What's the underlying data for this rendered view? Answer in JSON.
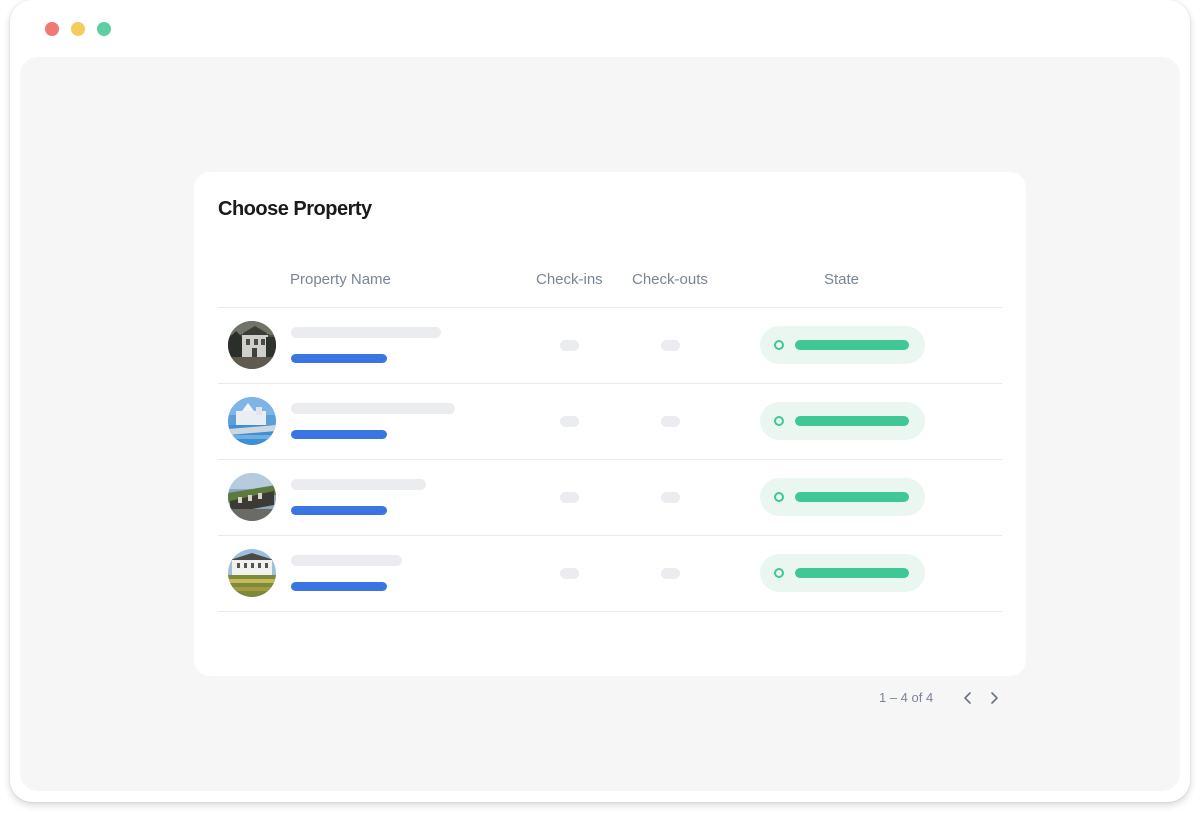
{
  "window": {
    "controls": [
      "close",
      "minimize",
      "maximize"
    ],
    "colors": {
      "close": "#ee7a72",
      "minimize": "#f3cb5e",
      "maximize": "#5fcfa2"
    }
  },
  "card": {
    "title": "Choose Property",
    "columns": {
      "name": "Property Name",
      "checkins": "Check-ins",
      "checkouts": "Check-outs",
      "state": "State"
    },
    "rows": [
      {
        "photo": "house-photo-icon",
        "state_color": "#3fc795"
      },
      {
        "photo": "pool-resort-photo-icon",
        "state_color": "#3fc795"
      },
      {
        "photo": "stone-building-photo-icon",
        "state_color": "#3fc795"
      },
      {
        "photo": "manor-garden-photo-icon",
        "state_color": "#3fc795"
      }
    ],
    "pagination": {
      "info": "1 – 4 of 4",
      "prev_icon": "chevron-left-icon",
      "next_icon": "chevron-right-icon"
    }
  },
  "colors": {
    "accent_blue": "#3b75e3",
    "status_green": "#3fc795",
    "status_bg": "#eaf7f1",
    "header_text": "#7a8497"
  }
}
